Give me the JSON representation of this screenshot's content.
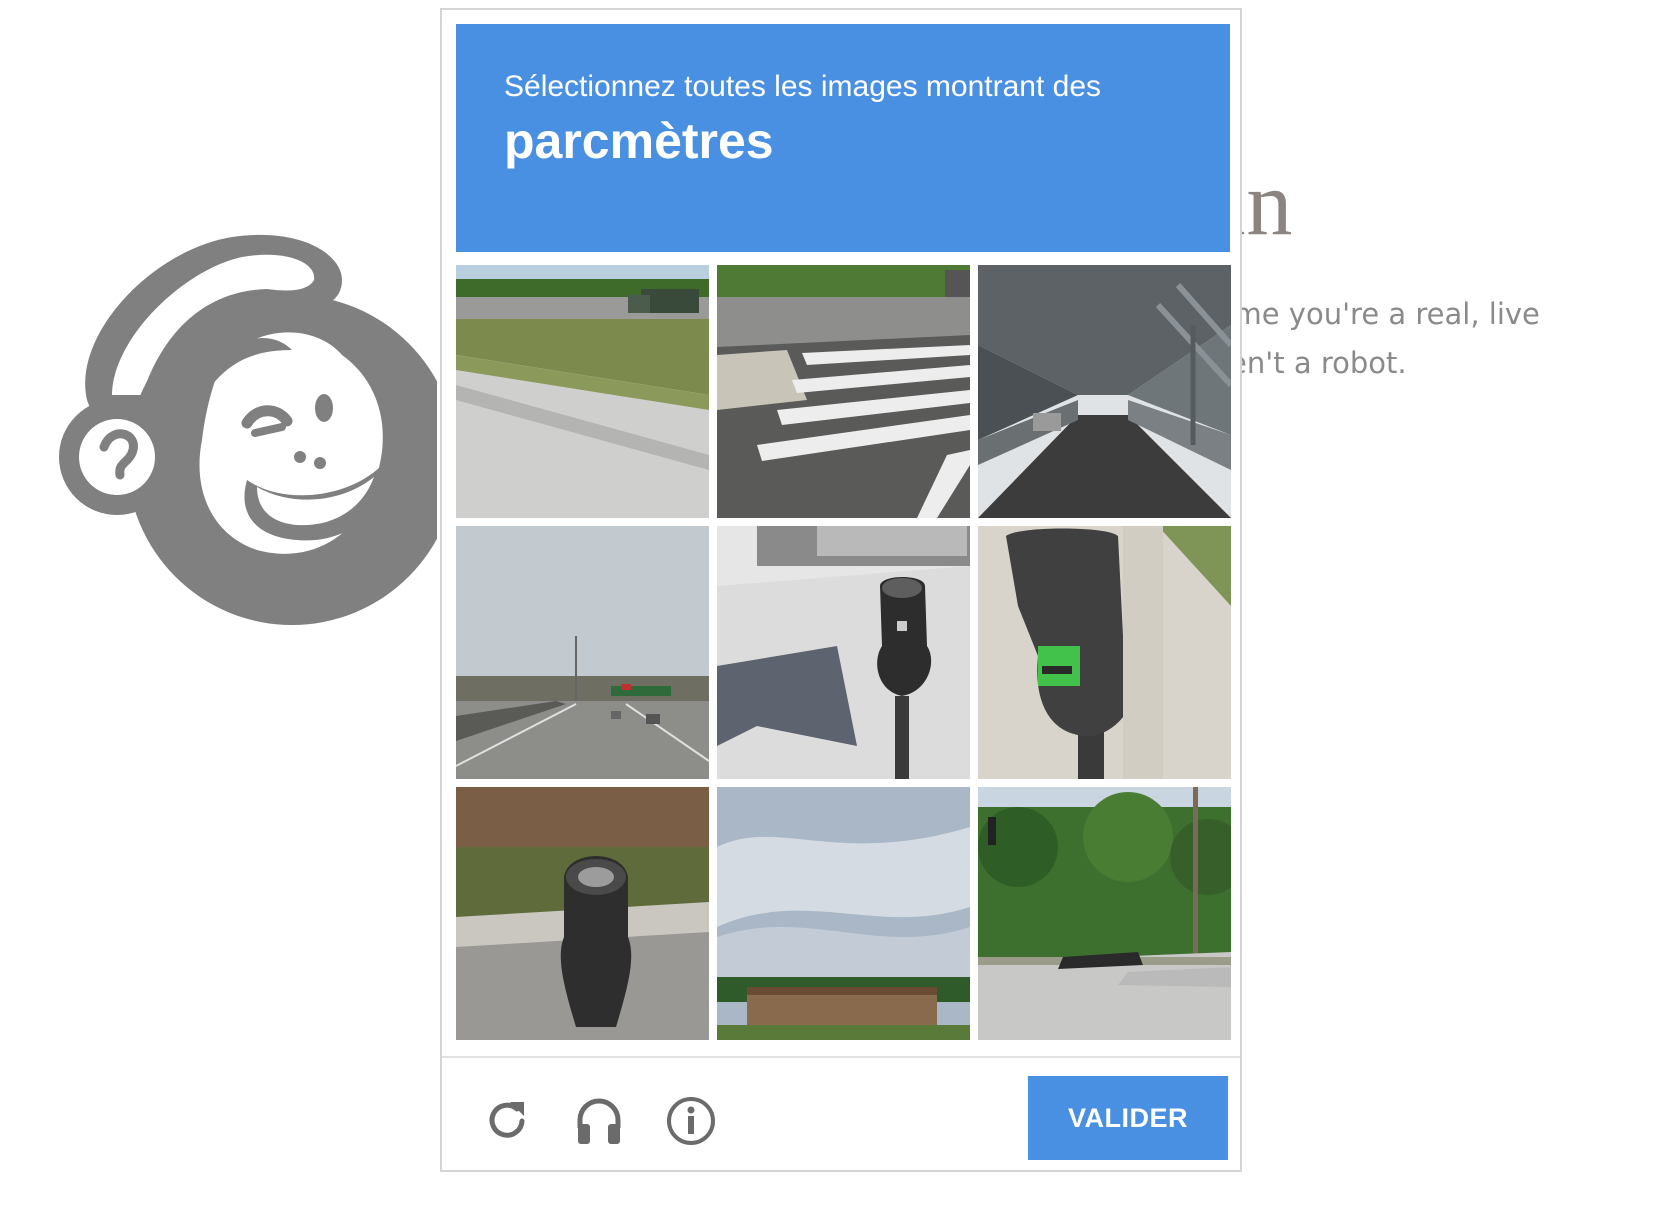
{
  "background": {
    "heading": "uman",
    "paragraph_lines": [
      "sume you're a real, live",
      "aren't a robot."
    ]
  },
  "captcha": {
    "instruction": "Sélectionnez toutes les images montrant des",
    "keyword": "parcmètres",
    "tiles": [
      {
        "scene": "highway-median-truck"
      },
      {
        "scene": "crosswalk-road"
      },
      {
        "scene": "steel-truss-bridge"
      },
      {
        "scene": "divided-highway"
      },
      {
        "scene": "parking-meter-sidewalk"
      },
      {
        "scene": "parking-meter-closeup"
      },
      {
        "scene": "parking-meter-barrier"
      },
      {
        "scene": "sky-building"
      },
      {
        "scene": "road-intersection-trees"
      }
    ],
    "tools": {
      "reload_icon": "reload-icon",
      "audio_icon": "headphones-icon",
      "info_icon": "info-icon"
    },
    "verify_label": "VALIDER",
    "colors": {
      "accent": "#4a90e2",
      "icon": "#6b6b6b",
      "logo": "#808080"
    }
  }
}
